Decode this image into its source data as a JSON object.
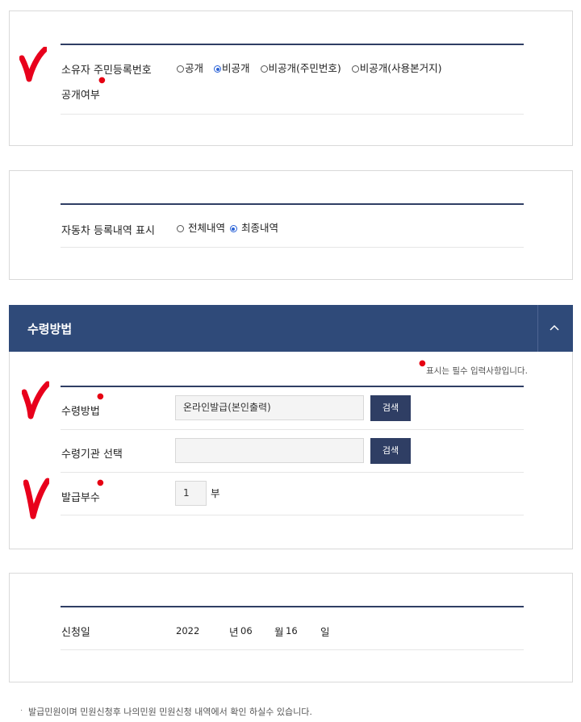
{
  "section1": {
    "label_line1": "소유자 주민등록번호",
    "label_line2": "공개여부",
    "options": [
      "공개",
      "비공개",
      "비공개(주민번호)",
      "비공개(사용본거지)"
    ],
    "selected": "비공개"
  },
  "section2": {
    "label": "자동차 등록내역 표시",
    "options": [
      "전체내역",
      "최종내역"
    ],
    "selected": "최종내역"
  },
  "section3": {
    "title": "수령방법",
    "required_note": "표시는 필수 입력사항입니다.",
    "method_label": "수령방법",
    "method_value": "온라인발급(본인출력)",
    "search_label": "검색",
    "agency_label": "수령기관 선택",
    "agency_value": "",
    "copies_label": "발급부수",
    "copies_value": "1",
    "copies_unit": "부"
  },
  "section4": {
    "date_label": "신청일",
    "year": "2022",
    "year_unit": "년",
    "month": "06",
    "month_unit": "월",
    "day": "16",
    "day_unit": "일"
  },
  "footer_note": "발급민원이며 민원신청후 나의민원 민원신청 내역에서 확인 하실수 있습니다.",
  "colors": {
    "navy": "#2f3e64",
    "header": "#2f4a79",
    "required": "#e60012",
    "annotation": "#e8001c"
  }
}
